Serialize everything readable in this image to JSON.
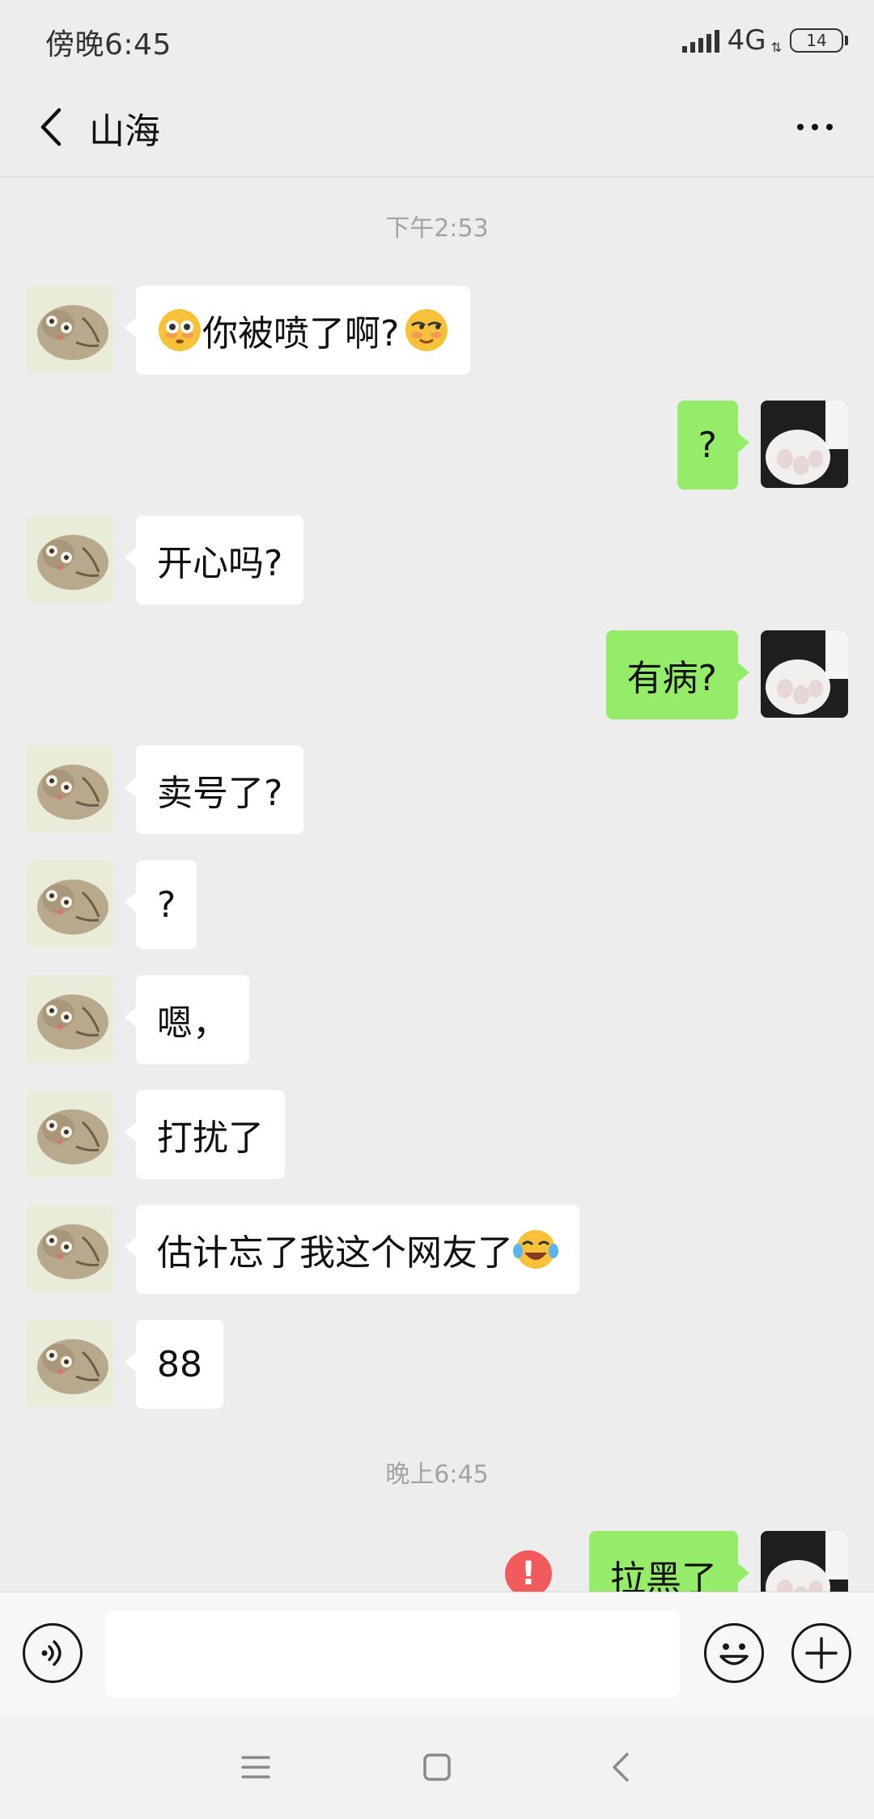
{
  "status_bar": {
    "time": "傍晚6:45",
    "network": "4G",
    "battery": "14"
  },
  "header": {
    "title": "山海"
  },
  "messages": {
    "timestamp_1": "下午2:53",
    "timestamp_2": "晚上6:45",
    "m1": {
      "sender": "contact",
      "text": "你被喷了啊?"
    },
    "m2": {
      "sender": "me",
      "text": "?"
    },
    "m3": {
      "sender": "contact",
      "text": "开心吗?"
    },
    "m4": {
      "sender": "me",
      "text": "有病?"
    },
    "m5": {
      "sender": "contact",
      "text": "卖号了?"
    },
    "m6": {
      "sender": "contact",
      "text": "?"
    },
    "m7": {
      "sender": "contact",
      "text": "嗯，"
    },
    "m8": {
      "sender": "contact",
      "text": "打扰了"
    },
    "m9": {
      "sender": "contact",
      "text": "估计忘了我这个网友了"
    },
    "m10": {
      "sender": "contact",
      "text": "88"
    },
    "m11": {
      "sender": "me",
      "text": "拉黑了",
      "error": "!"
    }
  },
  "colors": {
    "background": "#ededed",
    "sent_bubble": "#95ec69",
    "received_bubble": "#ffffff",
    "error": "#f25b5b",
    "timestamp_text": "#a3a3a3"
  },
  "icons": {
    "back": "chevron-left-icon",
    "more": "more-dots-icon",
    "voice": "voice-icon",
    "emoji": "emoji-icon",
    "plus": "plus-icon",
    "nav_menu": "menu-icon",
    "nav_home": "home-square-icon",
    "nav_back": "nav-back-icon"
  }
}
